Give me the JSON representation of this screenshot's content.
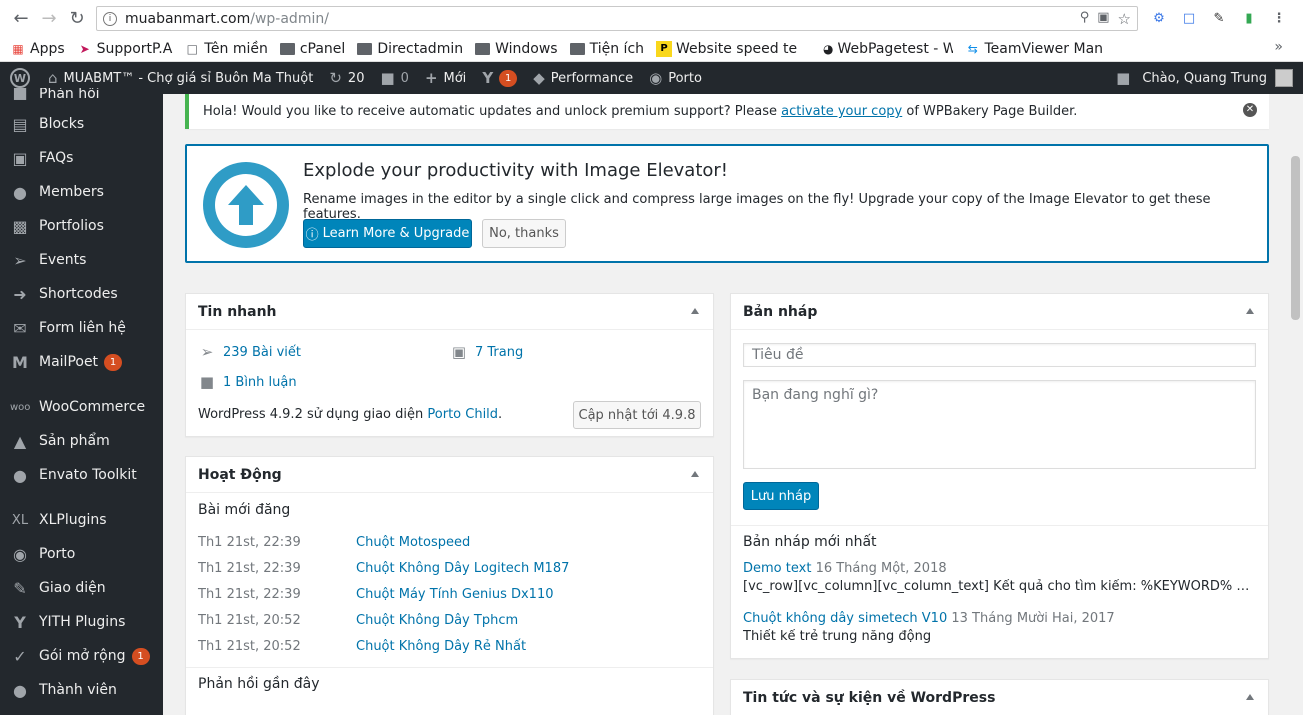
{
  "browser": {
    "url_host": "muabanmart.com",
    "url_path": "/wp-admin/",
    "bookmarks": [
      "Apps",
      "SupportP.A",
      "Tên miền",
      "cPanel",
      "Directadmin",
      "Windows",
      "Tiện ích",
      "Website speed te",
      "WebPagetest - W",
      "TeamViewer Man"
    ],
    "more": "»"
  },
  "adminbar": {
    "site_name": "MUABMT™ - Chợ giá sỉ Buôn Ma Thuột",
    "updates_count": "20",
    "comments_count": "0",
    "new_label": "Mới",
    "yoast_badge": "1",
    "performance_label": "Performance",
    "porto_label": "Porto",
    "greeting": "Chào, Quang Trung"
  },
  "sidebar": {
    "items": [
      {
        "label": "Phản hồi",
        "icon": "comment-icon"
      },
      {
        "label": "Blocks",
        "icon": "blocks-icon"
      },
      {
        "label": "FAQs",
        "icon": "faq-icon"
      },
      {
        "label": "Members",
        "icon": "members-icon"
      },
      {
        "label": "Portfolios",
        "icon": "portfolio-icon"
      },
      {
        "label": "Events",
        "icon": "pin-icon"
      },
      {
        "label": "Shortcodes",
        "icon": "shortcode-icon"
      },
      {
        "label": "Form liên hệ",
        "icon": "mail-icon"
      },
      {
        "label": "MailPoet",
        "icon": "mailpoet-icon",
        "badge": "1"
      },
      {
        "label": "WooCommerce",
        "icon": "woo-icon"
      },
      {
        "label": "Sản phẩm",
        "icon": "product-icon"
      },
      {
        "label": "Envato Toolkit",
        "icon": "envato-icon"
      },
      {
        "label": "XLPlugins",
        "icon": "xl-icon"
      },
      {
        "label": "Porto",
        "icon": "porto-icon"
      },
      {
        "label": "Giao diện",
        "icon": "brush-icon"
      },
      {
        "label": "YITH Plugins",
        "icon": "yith-icon"
      },
      {
        "label": "Gói mở rộng",
        "icon": "plugin-icon",
        "badge": "1"
      },
      {
        "label": "Thành viên",
        "icon": "user-icon"
      }
    ]
  },
  "notice": {
    "text_before": "Hola! Would you like to receive automatic updates and unlock premium support? Please",
    "link": "activate your copy",
    "text_after": "of WPBakery Page Builder."
  },
  "image_elevator": {
    "title": "Explode your productivity with Image Elevator!",
    "desc": "Rename images in the editor by a single click and compress large images on the fly! Upgrade your copy of the Image Elevator to get these features.",
    "primary_button": "Learn More & Upgrade",
    "secondary_button": "No, thanks"
  },
  "glance": {
    "title": "Tin nhanh",
    "posts": "239 Bài viết",
    "pages": "7 Trang",
    "comments": "1 Bình luận",
    "version_text": "WordPress 4.9.2 sử dụng giao diện",
    "theme_link": "Porto Child",
    "theme_dot": ".",
    "update_button": "Cập nhật tới 4.9.8"
  },
  "activity": {
    "title": "Hoạt Động",
    "recent_posts_title": "Bài mới đăng",
    "posts": [
      {
        "date": "Th1 21st, 22:39",
        "title": "Chuột Motospeed"
      },
      {
        "date": "Th1 21st, 22:39",
        "title": "Chuột Không Dây Logitech M187"
      },
      {
        "date": "Th1 21st, 22:39",
        "title": "Chuột Máy Tính Genius Dx110"
      },
      {
        "date": "Th1 21st, 20:52",
        "title": "Chuột Không Dây Tphcm"
      },
      {
        "date": "Th1 21st, 20:52",
        "title": "Chuột Không Dây Rẻ Nhất"
      }
    ],
    "recent_comments_title": "Phản hồi gần đây"
  },
  "quick_draft": {
    "title": "Bản nháp",
    "title_placeholder": "Tiêu đề",
    "content_placeholder": "Bạn đang nghĩ gì?",
    "save_button": "Lưu nháp",
    "drafts_title": "Bản nháp mới nhất",
    "drafts": [
      {
        "title": "Demo text",
        "date": "16 Tháng Một, 2018",
        "excerpt": "[vc_row][vc_column][vc_column_text] Kết quả cho tìm kiếm: %KEYWORD% Giá rẻ &…"
      },
      {
        "title": "Chuột không dây simetech V10",
        "date": "13 Tháng Mười Hai, 2017",
        "excerpt": "Thiết kế trẻ trung năng động"
      }
    ]
  },
  "news": {
    "title": "Tin tức và sự kiện về WordPress"
  }
}
